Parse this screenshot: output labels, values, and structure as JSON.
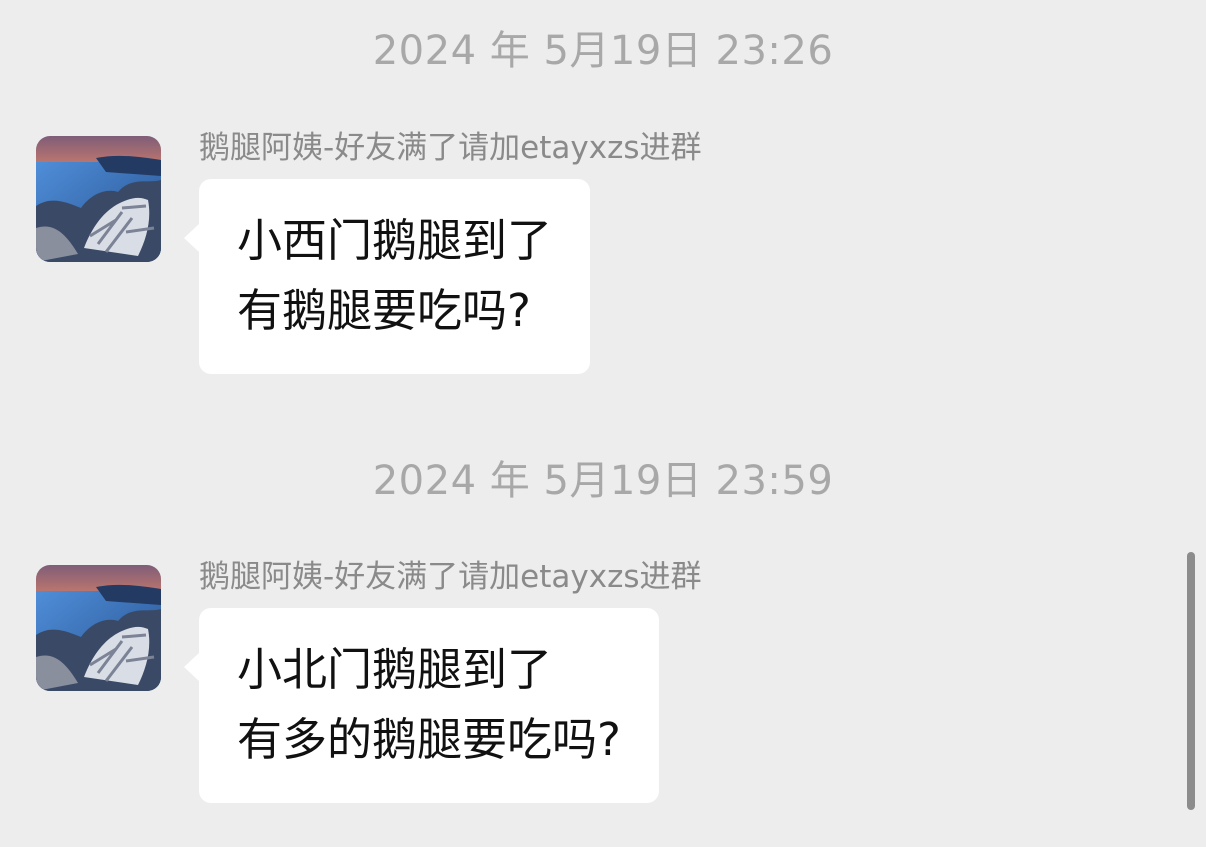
{
  "messages": [
    {
      "timestamp": "2024 年 5月19日 23:26",
      "sender": "鹅腿阿姨-好友满了请加etayxzs进群",
      "lines": [
        "小西门鹅腿到了",
        "有鹅腿要吃吗?"
      ]
    },
    {
      "timestamp": "2024 年 5月19日 23:59",
      "sender": "鹅腿阿姨-好友满了请加etayxzs进群",
      "lines": [
        "小北门鹅腿到了",
        "有多的鹅腿要吃吗?"
      ]
    }
  ],
  "colors": {
    "background": "#ededed",
    "bubble": "#ffffff",
    "timestamp_text": "#a8a8a8",
    "sender_text": "#8a8a8a",
    "message_text": "#111111",
    "scrollbar": "#8c8c8c"
  },
  "icons": {
    "avatar": "landscape-lake-driftwood-avatar"
  }
}
